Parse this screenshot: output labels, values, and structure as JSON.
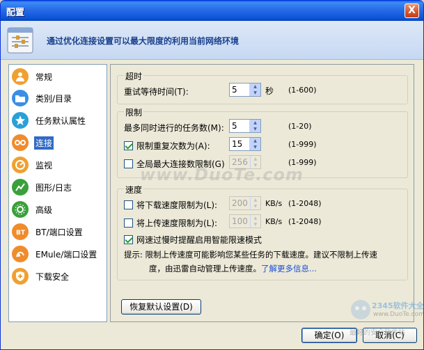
{
  "window": {
    "title": "配置",
    "close_glyph": "X"
  },
  "banner": {
    "text": "通过优化连接设置可以最大限度的利用当前网络环境",
    "icon": "settings-panel-icon"
  },
  "sidebar": {
    "items": [
      {
        "label": "常规",
        "icon": "person-icon",
        "color": "#f0a030"
      },
      {
        "label": "类别/目录",
        "icon": "folder-icon",
        "color": "#3a8ee6"
      },
      {
        "label": "任务默认属性",
        "icon": "gear-star-icon",
        "color": "#2aa0d8"
      },
      {
        "label": "连接",
        "icon": "connection-icon",
        "color": "#f08c2c",
        "active": true
      },
      {
        "label": "监视",
        "icon": "monitor-icon",
        "color": "#f0a030"
      },
      {
        "label": "图形/日志",
        "icon": "chart-icon",
        "color": "#3aa03a"
      },
      {
        "label": "高级",
        "icon": "advanced-gear-icon",
        "color": "#3aa03a"
      },
      {
        "label": "BT/端口设置",
        "icon": "bt-icon",
        "color": "#f08c2c"
      },
      {
        "label": "EMule/端口设置",
        "icon": "emule-icon",
        "color": "#f08c2c"
      },
      {
        "label": "下载安全",
        "icon": "shield-icon",
        "color": "#f0a030"
      }
    ]
  },
  "timeout": {
    "title": "超时",
    "retry_label": "重试等待时间(T):",
    "retry_value": "5",
    "retry_unit": "秒",
    "retry_range": "(1-600)"
  },
  "limits": {
    "title": "限制",
    "max_tasks_label": "最多同时进行的任务数(M):",
    "max_tasks_value": "5",
    "max_tasks_range": "(1-20)",
    "retry_limit_label": "限制重复次数为(A):",
    "retry_limit_checked": true,
    "retry_limit_value": "15",
    "retry_limit_range": "(1-999)",
    "global_conn_label": "全局最大连接数限制(G)",
    "global_conn_checked": false,
    "global_conn_value": "256",
    "global_conn_range": "(1-999)"
  },
  "speed": {
    "title": "速度",
    "download_label": "将下载速度限制为(L):",
    "download_checked": false,
    "download_value": "200",
    "download_unit": "KB/s",
    "download_range": "(1-2048)",
    "upload_label": "将上传速度限制为(L):",
    "upload_checked": false,
    "upload_value": "100",
    "upload_unit": "KB/s",
    "upload_range": "(1-2048)",
    "smart_label": "网速过慢时提醒启用智能限速模式",
    "smart_checked": true,
    "hint_line1": "提示: 限制上传速度可能影响您某些任务的下载速度。建议不限制上传速",
    "hint_line2": "度，由迅雷自动管理上传速度。",
    "hint_link": "了解更多信息..."
  },
  "buttons": {
    "restore": "恢复默认设置(D)",
    "ok": "确定(O)",
    "cancel": "取消(C)"
  },
  "watermark": "www.DuoTe.com",
  "corner": {
    "brand": "2345软件大全",
    "site": "www.DuoTe.com",
    "tagline": "最好的安全软件站"
  }
}
